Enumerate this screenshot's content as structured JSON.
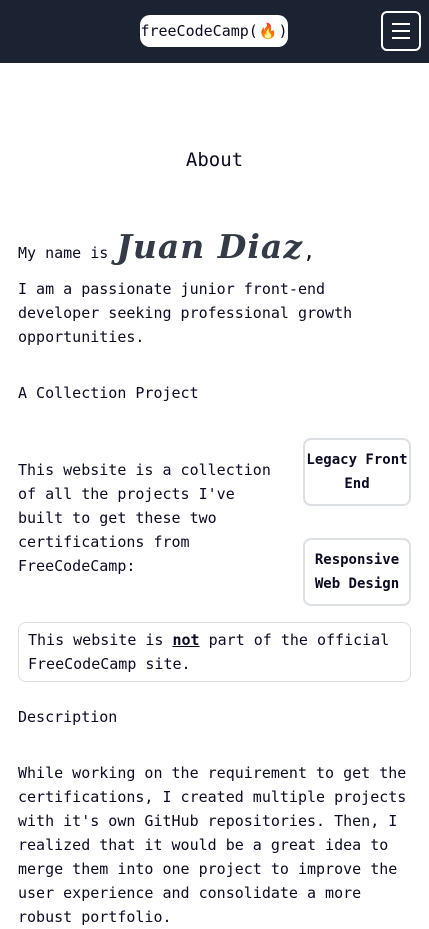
{
  "nav": {
    "brand_text": "freeCodeCamp(",
    "brand_flame": "☲",
    "brand_close": ")"
  },
  "page": {
    "title": "About",
    "intro_prefix": "My name is",
    "name": "Juan Diaz",
    "name_suffix": ",",
    "tagline": "I am a passionate junior front-end developer seeking professional growth opportunities.",
    "collection_heading": "A Collection Project",
    "collection_text": "This website is a collection of all the projects I've built to get these two certifications from FreeCodeCamp:",
    "certs": [
      {
        "label": "Legacy Front End"
      },
      {
        "label": "Responsive Web Design"
      }
    ],
    "notice_before": "This website is ",
    "notice_emphasis": "not",
    "notice_after": " part of the official FreeCodeCamp site.",
    "description_heading": "Description",
    "description_text": "While working on the requirement to get the certifications, I created multiple projects with it's own GitHub repositories. Then, I realized that it would be a great idea to merge them into one project to improve the user experience and consolidate a more robust portfolio."
  }
}
